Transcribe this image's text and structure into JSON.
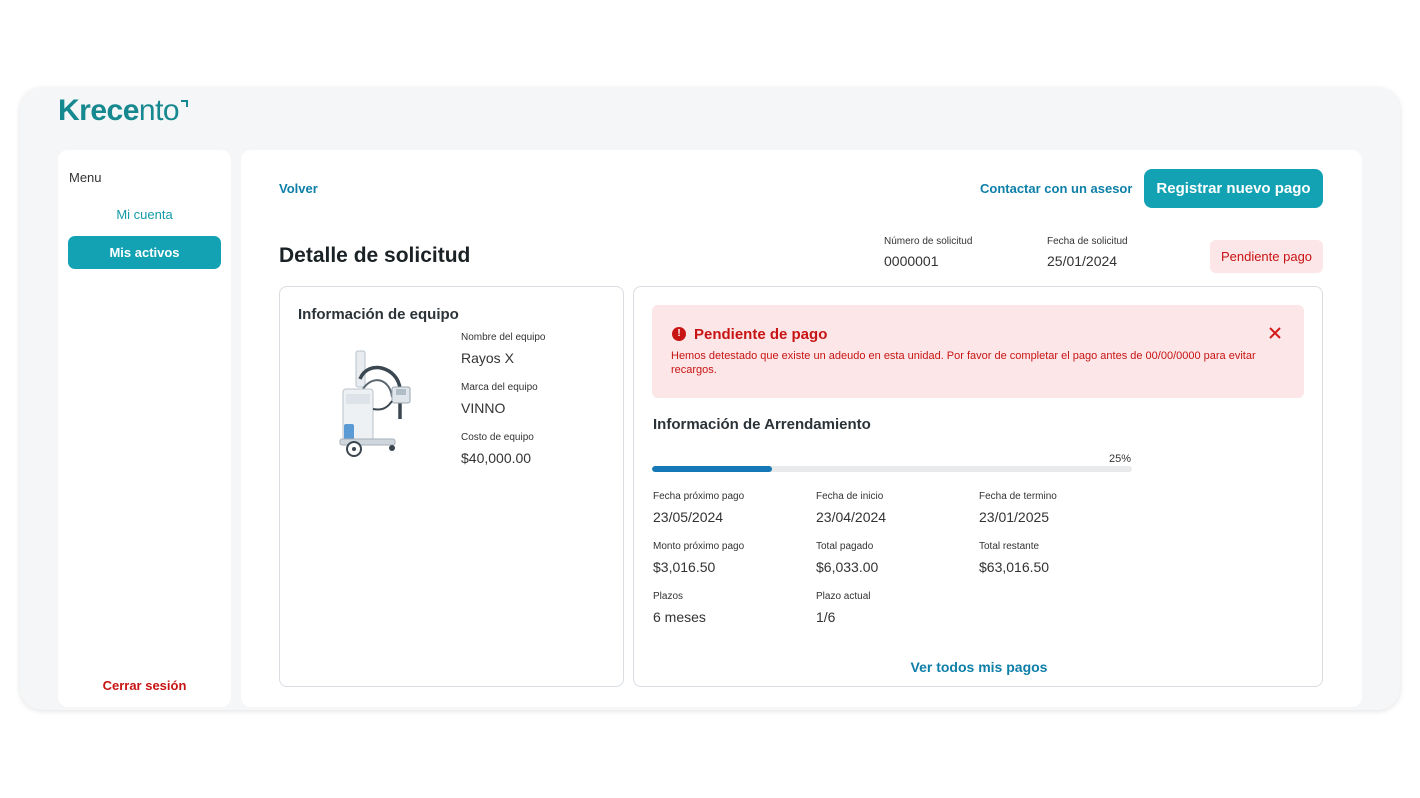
{
  "brand": {
    "name_bold": "Krec",
    "name_mid": "e",
    "name_light": "nto",
    "color": "#15898f"
  },
  "sidebar": {
    "menu_title": "Menu",
    "items": [
      {
        "label": "Mi cuenta",
        "active": false
      },
      {
        "label": "Mis activos",
        "active": true
      }
    ],
    "logout_label": "Cerrar sesión"
  },
  "header": {
    "back_label": "Volver",
    "contact_label": "Contactar con un asesor",
    "primary_button_label": "Registrar nuevo pago"
  },
  "detail": {
    "title": "Detalle de solicitud",
    "request_number_label": "Número de solicitud",
    "request_number": "0000001",
    "request_date_label": "Fecha de solicitud",
    "request_date": "25/01/2024",
    "status": "Pendiente pago"
  },
  "equipment": {
    "section_title": "Información de equipo",
    "name_label": "Nombre del equipo",
    "name": "Rayos X",
    "brand_label": "Marca del equipo",
    "brand": "VINNO",
    "cost_label": "Costo de equipo",
    "cost": "$40,000.00",
    "image_icon": "x-ray-machine-image"
  },
  "alert": {
    "title": "Pendiente de pago",
    "message": "Hemos detestado que existe un adeudo en esta unidad. Por favor de completar el pago antes de 00/00/0000 para evitar recargos.",
    "icon": "exclamation-icon",
    "close_icon": "close-icon"
  },
  "lease": {
    "section_title": "Información de Arrendamiento",
    "progress_label": "25%",
    "progress_fraction": 0.25,
    "fields": [
      {
        "label": "Fecha próximo pago",
        "value": "23/05/2024"
      },
      {
        "label": "Fecha de inicio",
        "value": "23/04/2024"
      },
      {
        "label": "Fecha de termino",
        "value": "23/01/2025"
      },
      {
        "label": "Monto próximo pago",
        "value": "$3,016.50"
      },
      {
        "label": "Total pagado",
        "value": "$6,033.00"
      },
      {
        "label": "Total restante",
        "value": "$63,016.50"
      },
      {
        "label": "Plazos",
        "value": "6 meses"
      },
      {
        "label": "Plazo actual",
        "value": "1/6"
      }
    ],
    "view_all_label": "Ver todos mis pagos"
  },
  "colors": {
    "accent": "#12a2b4",
    "link": "#0e7fa8",
    "danger": "#c81414",
    "danger_bg": "#fce6e7",
    "progress": "#1479b6"
  }
}
